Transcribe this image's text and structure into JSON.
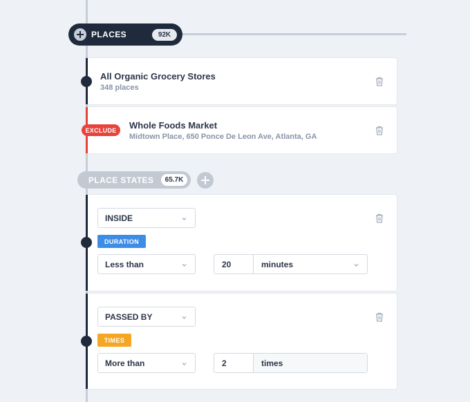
{
  "places": {
    "label": "PLACES",
    "count": "92K",
    "items": [
      {
        "title": "All Organic Grocery Stores",
        "subtitle": "348 places",
        "excluded": false
      },
      {
        "title": "Whole Foods Market",
        "subtitle": "Midtown Place, 650 Ponce De Leon Ave, Atlanta, GA",
        "excluded": true,
        "badge": "EXCLUDE"
      }
    ]
  },
  "place_states": {
    "label": "PLACE STATES",
    "count": "65.7K",
    "rules": [
      {
        "state": "INSIDE",
        "tag": "DURATION",
        "comparator": "Less than",
        "value": "20",
        "unit": "minutes"
      },
      {
        "state": "PASSED BY",
        "tag": "TIMES",
        "comparator": "More than",
        "value": "2",
        "unit": "times"
      }
    ]
  },
  "colors": {
    "navy": "#1f2a3d",
    "exclude_red": "#e8433a",
    "duration_blue": "#3d8de5",
    "times_orange": "#f5a623"
  }
}
